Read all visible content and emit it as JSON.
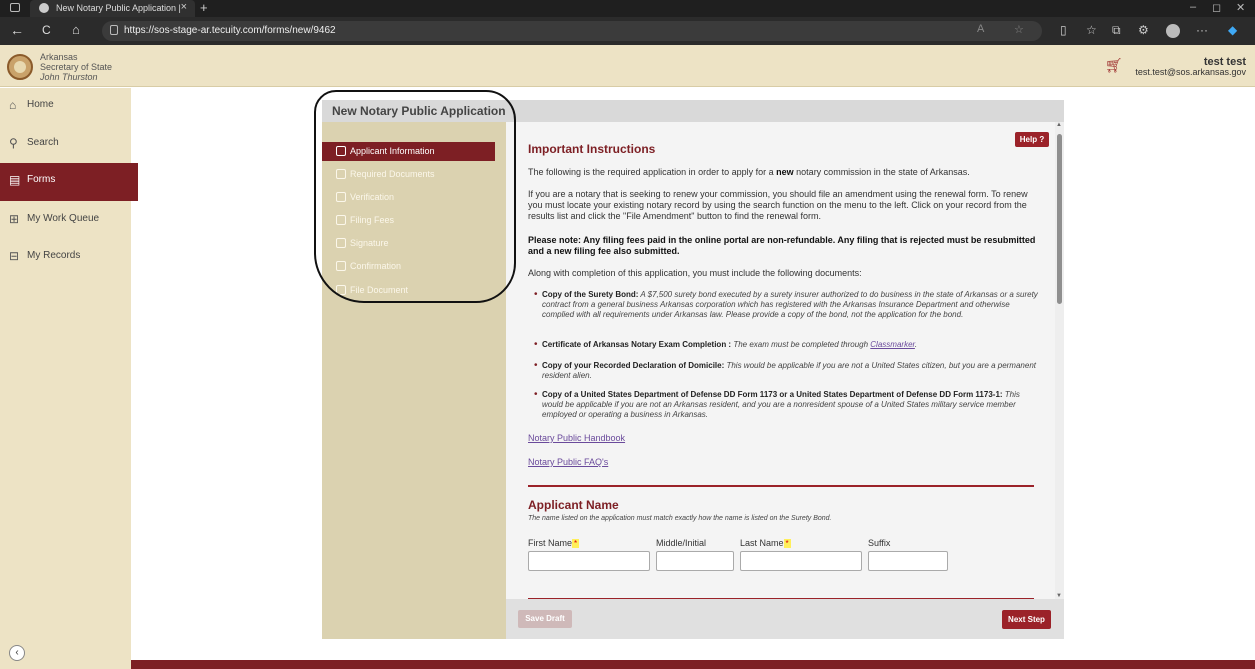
{
  "browser": {
    "tab_title": "New Notary Public Application |",
    "tab_close": "×",
    "new_tab": "+",
    "url": "https://sos-stage-ar.tecuity.com/forms/new/9462",
    "back": "←",
    "refresh": "C",
    "home": "⌂",
    "more": "···"
  },
  "header": {
    "org_line1": "Arkansas",
    "org_line2": "Secretary of State",
    "org_line3": "John Thurston",
    "user_name": "test test",
    "user_email": "test.test@sos.arkansas.gov"
  },
  "sidebar": {
    "items": [
      {
        "label": "Home",
        "icon": "home-icon"
      },
      {
        "label": "Search",
        "icon": "search-icon"
      },
      {
        "label": "Forms",
        "icon": "forms-icon"
      },
      {
        "label": "My Work Queue",
        "icon": "work-queue-icon"
      },
      {
        "label": "My Records",
        "icon": "records-icon"
      }
    ],
    "collapse": "‹"
  },
  "form": {
    "title": "New Notary Public Application",
    "steps": [
      {
        "label": "Applicant Information"
      },
      {
        "label": "Required Documents"
      },
      {
        "label": "Verification"
      },
      {
        "label": "Filing Fees"
      },
      {
        "label": "Signature"
      },
      {
        "label": "Confirmation"
      },
      {
        "label": "File Document"
      }
    ],
    "help_label": "Help ?",
    "instructions": {
      "heading": "Important Instructions",
      "p1_a": "The following is the required application in order to apply for a ",
      "p1_b": "new",
      "p1_c": " notary commission in the state of Arkansas.",
      "p2": "If you are a notary that is seeking to renew your commission, you should file an amendment using the renewal form. To renew you must locate your existing notary record by using the search function on the menu to the left. Click on your record from the results list and click the \"File Amendment\" button to find the renewal form.",
      "p3": "Please note: Any filing fees paid in the online portal are non-refundable. Any filing that is rejected must be resubmitted and a new filing fee also submitted.",
      "p4": "Along with completion of this application, you must include the following documents:",
      "b1_bold": "Copy of the Surety Bond:",
      "b1_text": " A $7,500 surety bond executed by a surety insurer authorized to do business in the state of Arkansas or a surety contract from a general business Arkansas corporation which has registered with the Arkansas Insurance Department and otherwise complied with all requirements under Arkansas law. Please provide a copy of the bond, not the application for the bond.",
      "b2_bold": "Certificate of Arkansas Notary Exam Completion :",
      "b2_text": " The exam must be completed through ",
      "b2_link": "Classmarker",
      "b2_end": ".",
      "b3_bold": "Copy of your Recorded Declaration of Domicile:",
      "b3_text": " This would be applicable if you are not a United States citizen, but you are a permanent resident alien.",
      "b4_bold": "Copy of a United States Department of Defense DD Form 1173 or a United States Department of Defense DD Form 1173-1:",
      "b4_text": " This would be applicable if you are not an Arkansas resident, and you are a nonresident spouse of a United States military service member employed or operating a business in Arkansas.",
      "link_handbook": "Notary Public Handbook",
      "link_faq": "Notary Public FAQ's"
    },
    "applicant_name": {
      "heading": "Applicant Name",
      "subtitle": "The name listed on the application must match exactly how the name is listed on the Surety Bond.",
      "first_name_label": "First Name",
      "middle_label": "Middle/Initial",
      "last_name_label": "Last Name",
      "suffix_label": "Suffix",
      "required_mark": "*",
      "first_name_value": "",
      "middle_value": "",
      "last_name_value": "",
      "suffix_value": ""
    },
    "save_draft": "Save Draft",
    "next_step": "Next Step"
  }
}
